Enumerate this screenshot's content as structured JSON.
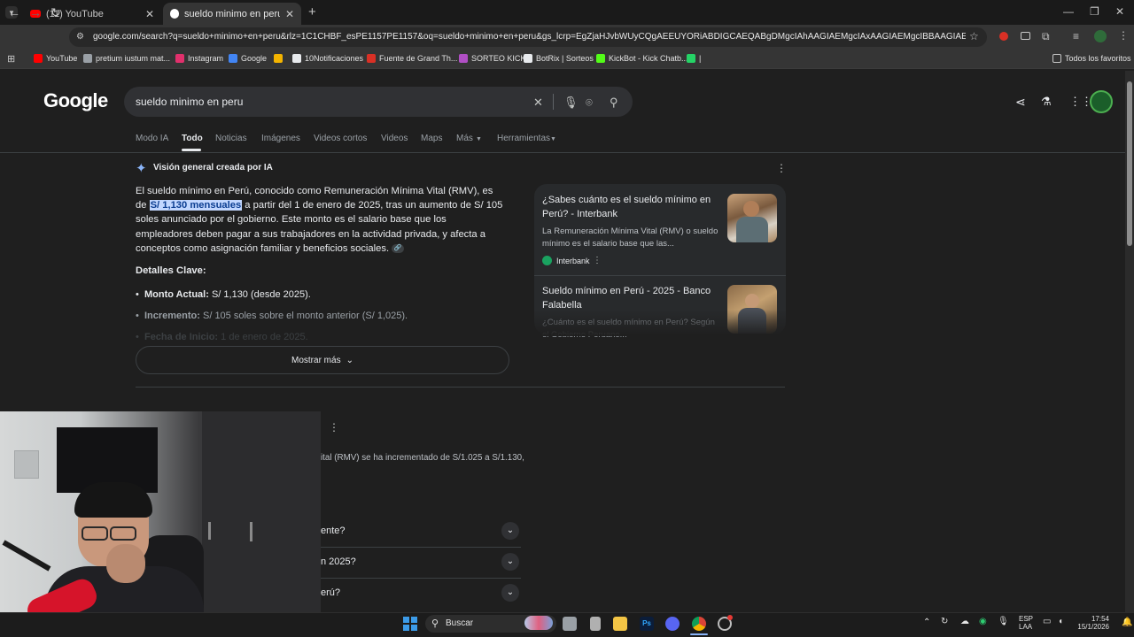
{
  "browser": {
    "tabs": [
      {
        "label": "(11) YouTube",
        "active": false
      },
      {
        "label": "sueldo minimo en peru - Buscar",
        "active": true
      }
    ],
    "url": "google.com/search?q=sueldo+minimo+en+peru&rlz=1C1CHBF_esPE1157PE1157&oq=sueldo+minimo+en+peru&gs_lcrp=EgZjaHJvbWUyCQgAEEUYORiABDIGCAEQABgDMgcIAhAAGIAEMgcIAxAAGIAEMgcIBBAAGIAEMgcIBRAAGIAEMg...",
    "bookmarks": [
      {
        "label": "YouTube",
        "color": "#ff0000"
      },
      {
        "label": "pretium iustum mat...",
        "color": "#9aa0a6"
      },
      {
        "label": "Instagram",
        "color": "#e1306c"
      },
      {
        "label": "Google",
        "color": "#4285f4"
      },
      {
        "label": "",
        "color": "#f4b400"
      },
      {
        "label": "10Notificaciones",
        "color": "#e8eaed"
      },
      {
        "label": "Fuente de Grand Th...",
        "color": "#d93025"
      },
      {
        "label": "SORTEO KICK",
        "color": "#b14fc5"
      },
      {
        "label": "BotRix | Sorteos",
        "color": "#e8eaed"
      },
      {
        "label": "KickBot - Kick Chatb...",
        "color": "#53fc18"
      },
      {
        "label": "|",
        "color": "#25d366"
      }
    ],
    "all_bookmarks": "Todos los favoritos"
  },
  "google": {
    "logo": "Google",
    "query": "sueldo minimo en peru",
    "tabs": [
      "Modo IA",
      "Todo",
      "Noticias",
      "Imágenes",
      "Videos cortos",
      "Videos",
      "Maps",
      "Más",
      "Herramientas"
    ],
    "active_tab": "Todo"
  },
  "ai_overview": {
    "title": "Visión general creada por IA",
    "para_pre": "El sueldo mínimo en Perú, conocido como Remuneración Mínima Vital (RMV), es de ",
    "para_hl": "S/ 1,130 mensuales",
    "para_post": " a partir del 1 de enero de 2025, tras un aumento de S/ 105 soles anunciado por el gobierno. Este monto es el salario base que los empleadores deben pagar a sus trabajadores en la actividad privada, y afecta a conceptos como asignación familiar y beneficios sociales.",
    "details_heading": "Detalles Clave:",
    "details": [
      {
        "label": "Monto Actual:",
        "text": " S/ 1,130 (desde 2025)."
      },
      {
        "label": "Incremento:",
        "text": " S/ 105 soles sobre el monto anterior (S/ 1,025)."
      },
      {
        "label": "Fecha de Inicio:",
        "text": " 1 de enero de 2025."
      }
    ],
    "show_more": "Mostrar más"
  },
  "sources": [
    {
      "title": "¿Sabes cuánto es el sueldo mínimo en Perú? - Interbank",
      "snippet": "La Remuneración Mínima Vital (RMV) o sueldo mínimo es el salario base que las...",
      "site": "Interbank"
    },
    {
      "title": "Sueldo mínimo en Perú - 2025 - Banco Falabella",
      "snippet": "¿Cuánto es el sueldo mínimo en Perú? Según el Gobierno Peruano..."
    }
  ],
  "results": {
    "snippet": "ital (RMV) se ha incrementado de S/1.025 a S/1.130,",
    "questions": [
      "ente?",
      "n 2025?",
      "erú?"
    ]
  },
  "taskbar": {
    "search": "Buscar",
    "lang": "ESP",
    "lang2": "LAA",
    "time": "17:54",
    "date": "15/1/2026"
  }
}
